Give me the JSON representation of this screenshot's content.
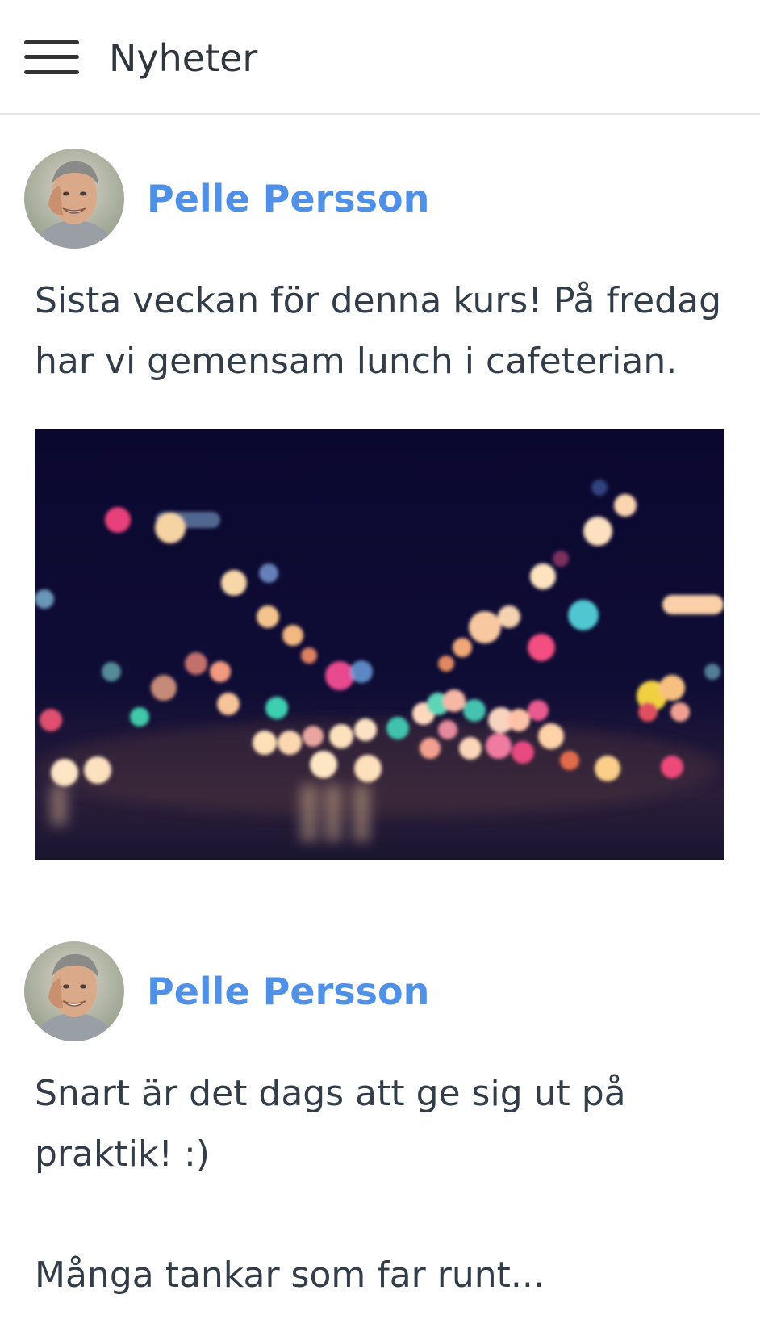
{
  "app_bar": {
    "menu_icon": "hamburger-menu-icon",
    "title": "Nyheter"
  },
  "posts": [
    {
      "author": "Pelle Persson",
      "avatar": "avatar-photo",
      "text": "Sista veckan för denna kurs! På fredag har vi gemensam lunch i cafeterian.",
      "image": "bokeh-city-lights-photo"
    },
    {
      "author": "Pelle Persson",
      "avatar": "avatar-photo",
      "text": "Snart är det dags att ge sig ut på praktik! :)\n\nMånga tankar som far runt..."
    }
  ]
}
